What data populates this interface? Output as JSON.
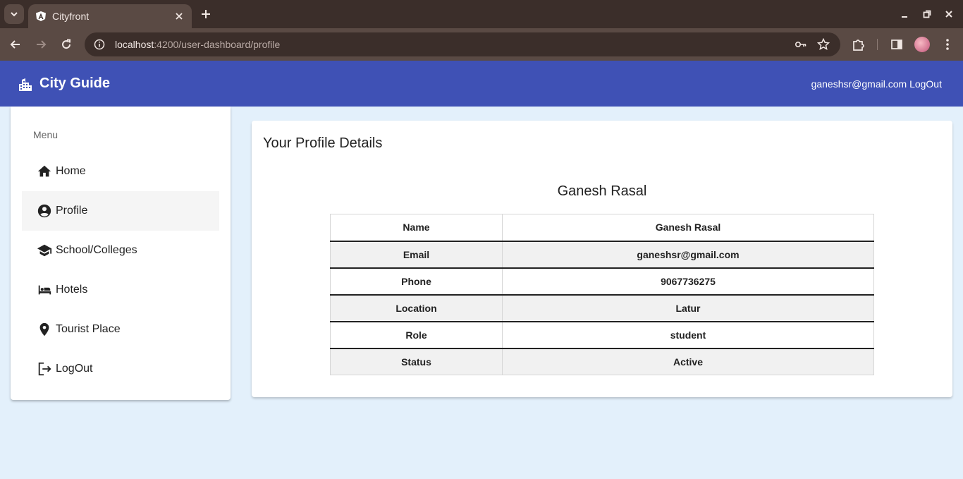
{
  "browser": {
    "tab_title": "Cityfront",
    "url_host": "localhost",
    "url_rest": ":4200/user-dashboard/profile"
  },
  "header": {
    "brand_icon": "city-building-icon",
    "title": "City Guide",
    "user_email": "ganeshsr@gmail.com",
    "logout_label": "LogOut"
  },
  "sidebar": {
    "menu_label": "Menu",
    "items": [
      {
        "label": "Home",
        "icon": "home-icon"
      },
      {
        "label": "Profile",
        "icon": "account-circle-icon"
      },
      {
        "label": "School/Colleges",
        "icon": "school-icon"
      },
      {
        "label": "Hotels",
        "icon": "hotel-icon"
      },
      {
        "label": "Tourist Place",
        "icon": "location-pin-icon"
      },
      {
        "label": "LogOut",
        "icon": "logout-icon"
      }
    ],
    "active_index": 1
  },
  "main": {
    "title": "Your Profile Details",
    "profile_name": "Ganesh Rasal",
    "rows": [
      {
        "label": "Name",
        "value": "Ganesh Rasal"
      },
      {
        "label": "Email",
        "value": "ganeshsr@gmail.com"
      },
      {
        "label": "Phone",
        "value": "9067736275"
      },
      {
        "label": "Location",
        "value": "Latur"
      },
      {
        "label": "Role",
        "value": "student"
      },
      {
        "label": "Status",
        "value": "Active"
      }
    ]
  },
  "colors": {
    "header_bg": "#3f51b5",
    "page_bg": "#e3f0fb",
    "active_item_bg": "#f5f5f5"
  }
}
